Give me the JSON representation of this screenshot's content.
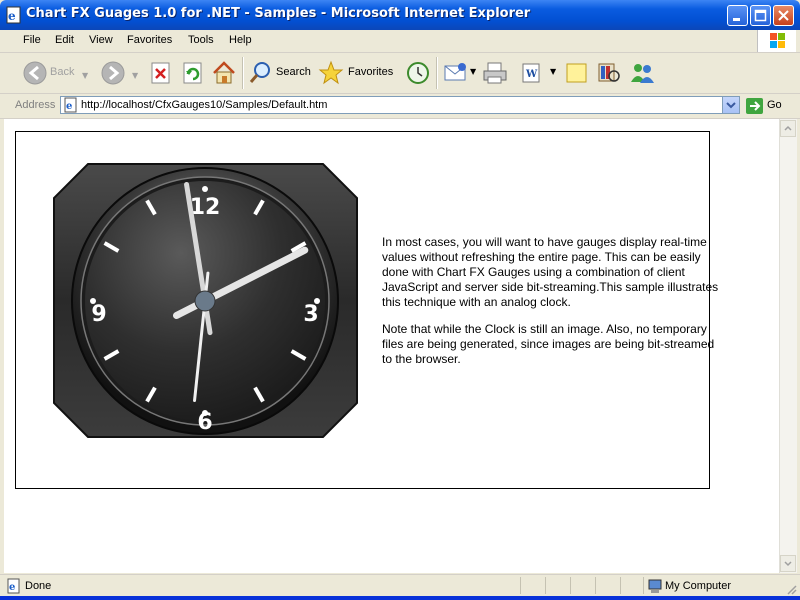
{
  "window": {
    "title": "Chart FX Guages 1.0 for .NET - Samples - Microsoft Internet Explorer",
    "icon": "ie-page-icon"
  },
  "menu": [
    "File",
    "Edit",
    "View",
    "Favorites",
    "Tools",
    "Help"
  ],
  "toolbar": {
    "back_label": "Back",
    "search_label": "Search",
    "favorites_label": "Favorites"
  },
  "address": {
    "label": "Address",
    "url": "http://localhost/CfxGauges10/Samples/Default.htm",
    "go_label": "Go"
  },
  "page": {
    "clock": {
      "numerals": [
        "12",
        "3",
        "6",
        "9"
      ],
      "hour": 2.1,
      "minute": 58.5,
      "second": 31
    },
    "paragraphs": [
      "In most cases, you will want to have gauges display real-time values without refreshing the entire page. This can be easily done with Chart FX Gauges using a combination of client JavaScript and server side bit-streaming.This sample illustrates this technique with an analog clock.",
      "Note that while the Clock is still an image. Also, no temporary files are being generated, since images are being bit-streamed to the browser."
    ]
  },
  "status": {
    "text": "Done",
    "zone": "My Computer"
  },
  "colors": {
    "titlebar": "#0a5ce0",
    "chrome": "#ece9d8",
    "clock_face": "#2a2a2a"
  }
}
